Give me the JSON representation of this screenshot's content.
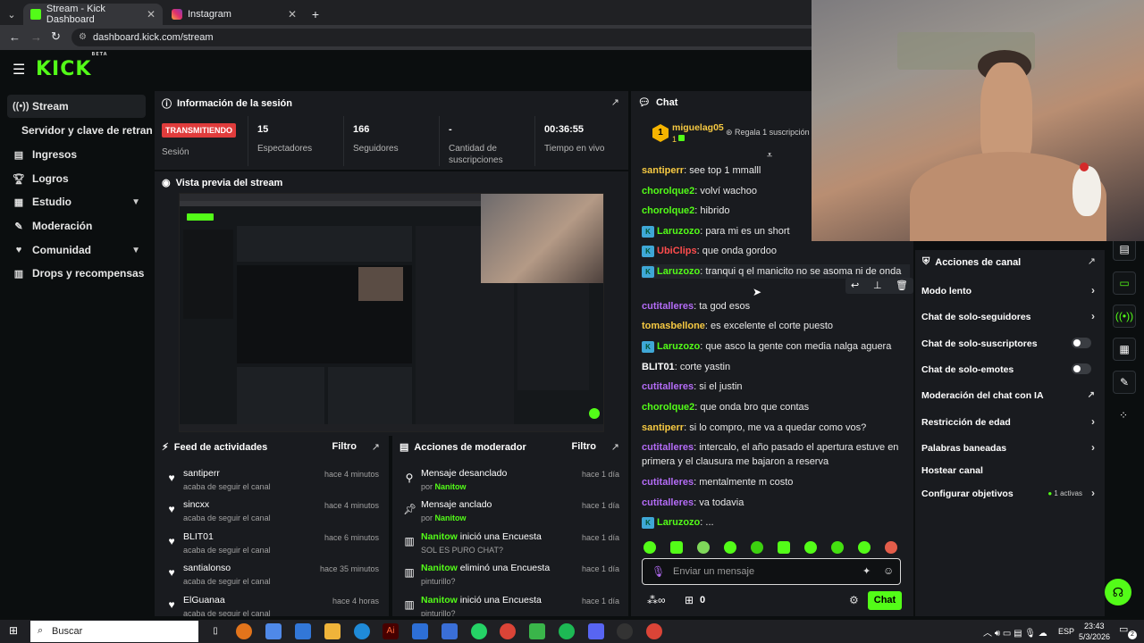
{
  "browser": {
    "tabs": [
      {
        "label": "Stream - Kick Dashboard",
        "icon": "kick-icon",
        "active": true
      },
      {
        "label": "Instagram",
        "icon": "instagram-icon",
        "active": false
      }
    ],
    "new_tab": "+",
    "url": "dashboard.kick.com/stream"
  },
  "brand": {
    "logo": "KICK",
    "logo_sup": "BETA",
    "accent": "#53fc18"
  },
  "sidebar": {
    "items": [
      {
        "label": "Stream",
        "icon": "stream-icon"
      },
      {
        "label": "Servidor y clave de retransm"
      },
      {
        "label": "Ingresos",
        "icon": "wallet-icon"
      },
      {
        "label": "Logros",
        "icon": "trophy-icon"
      },
      {
        "label": "Estudio",
        "icon": "studio-icon"
      },
      {
        "label": "Moderación",
        "icon": "wrench-icon"
      },
      {
        "label": "Comunidad",
        "icon": "community-icon"
      },
      {
        "label": "Drops y recompensas",
        "icon": "gift-icon"
      }
    ]
  },
  "session": {
    "title": "Información de la sesión",
    "status_badge": "TRANSMITIENDO",
    "status_label": "Sesión",
    "stats": [
      {
        "value": "15",
        "label": "Espectadores"
      },
      {
        "value": "166",
        "label": "Seguidores"
      },
      {
        "value": "-",
        "label": "Cantidad de suscripciones"
      },
      {
        "value": "00:36:55",
        "label": "Tiempo en vivo"
      }
    ]
  },
  "preview": {
    "title": "Vista previa del stream"
  },
  "activity": {
    "title": "Feed de actividades",
    "filter": "Filtro",
    "items": [
      {
        "name": "santiperr",
        "sub": "acaba de seguir el canal",
        "time": "hace 4 minutos"
      },
      {
        "name": "sincxx",
        "sub": "acaba de seguir el canal",
        "time": "hace 4 minutos"
      },
      {
        "name": "BLIT01",
        "sub": "acaba de seguir el canal",
        "time": "hace 6 minutos"
      },
      {
        "name": "santialonso",
        "sub": "acaba de seguir el canal",
        "time": "hace 35 minutos"
      },
      {
        "name": "ElGuanaa",
        "sub": "acaba de seguir el canal",
        "time": "hace 4 horas"
      }
    ]
  },
  "modactions": {
    "title": "Acciones de moderador",
    "filter": "Filtro",
    "items": [
      {
        "pre": "",
        "action": "Mensaje desanclado",
        "sub_pre": "por ",
        "sub_user": "Nanitow",
        "sub": "",
        "time": "hace 1 día",
        "icon": "unpin-icon"
      },
      {
        "pre": "",
        "action": "Mensaje anclado",
        "sub_pre": "por ",
        "sub_user": "Nanitow",
        "sub": "",
        "time": "hace 1 día",
        "icon": "pin-icon"
      },
      {
        "pre": "Nanitow",
        "action": " inició una Encuesta",
        "sub_pre": "",
        "sub_user": "",
        "sub": "SOL ES PURO CHAT?",
        "time": "hace 1 día",
        "icon": "poll-icon"
      },
      {
        "pre": "Nanitow",
        "action": " eliminó una Encuesta",
        "sub_pre": "",
        "sub_user": "",
        "sub": "pinturillo?",
        "time": "hace 1 día",
        "icon": "poll-icon"
      },
      {
        "pre": "Nanitow",
        "action": " inició una Encuesta",
        "sub_pre": "",
        "sub_user": "",
        "sub": "pinturillo?",
        "time": "hace 1 día",
        "icon": "poll-icon"
      }
    ]
  },
  "chat": {
    "title": "Chat",
    "pinned_user": "miguelag05",
    "pinned_count": "1",
    "pinned_rank": "1",
    "pinned_action": "Regala 1 suscripción",
    "messages": [
      {
        "user": "santiperr",
        "text": "see top 1 mmalll",
        "color": "yellow",
        "badge": false
      },
      {
        "user": "chorolque2",
        "text": "volví wachoo",
        "color": "green",
        "badge": false
      },
      {
        "user": "chorolque2",
        "text": "hibrido",
        "color": "green",
        "badge": false
      },
      {
        "user": "Laruzozo",
        "text": "para mi es un short",
        "color": "green",
        "badge": true
      },
      {
        "user": "UbiClips",
        "text": "que onda gordoo",
        "color": "red",
        "badge": true
      },
      {
        "user": "Laruzozo",
        "text": "tranqui q el manicito no se asoma ni de onda",
        "color": "green",
        "badge": true
      },
      {
        "user": "cutitalleres",
        "text": "ta god esos",
        "color": "purple",
        "badge": false
      },
      {
        "user": "tomasbellone",
        "text": "es excelente el corte puesto",
        "color": "yellow",
        "badge": false
      },
      {
        "user": "Laruzozo",
        "text": "que asco la gente con media nalga aguera",
        "color": "green",
        "badge": true
      },
      {
        "user": "BLIT01",
        "text": "corte yastin",
        "color": "white",
        "badge": false
      },
      {
        "user": "cutitalleres",
        "text": "si el justin",
        "color": "purple",
        "badge": false
      },
      {
        "user": "chorolque2",
        "text": "que onda bro que contas",
        "color": "green",
        "badge": false
      },
      {
        "user": "santiperr",
        "text": "si lo compro, me va a quedar como vos?",
        "color": "yellow",
        "badge": false
      },
      {
        "user": "cutitalleres",
        "text": "intercalo, el año pasado el apertura estuve en primera y el clausura me bajaron a reserva",
        "color": "purple",
        "badge": false
      },
      {
        "user": "cutitalleres",
        "text": "mentalmente m costo",
        "color": "purple",
        "badge": false
      },
      {
        "user": "cutitalleres",
        "text": "va todavia",
        "color": "purple",
        "badge": false
      },
      {
        "user": "Laruzozo",
        "text": "...",
        "color": "green",
        "badge": true
      }
    ],
    "input_placeholder": "Enviar un mensaje",
    "points": "0",
    "send_label": "Chat"
  },
  "channel_actions": {
    "title": "Acciones de canal",
    "items": [
      {
        "label": "Modo lento",
        "control": "chevron"
      },
      {
        "label": "Chat de solo-seguidores",
        "control": "chevron"
      },
      {
        "label": "Chat de solo-suscriptores",
        "control": "toggle"
      },
      {
        "label": "Chat de solo-emotes",
        "control": "toggle"
      },
      {
        "label": "Moderación del chat con IA",
        "control": "external"
      },
      {
        "label": "Restricción de edad",
        "control": "chevron"
      },
      {
        "label": "Palabras baneadas",
        "control": "chevron"
      },
      {
        "label": "Hostear canal",
        "control": "none"
      },
      {
        "label": "Configurar objetivos",
        "control": "chevron",
        "extra": "1 activas"
      }
    ]
  },
  "taskbar": {
    "search": "Buscar",
    "lang": "ESP",
    "time": "23:43",
    "date": "5/3/2026",
    "notif": "2"
  }
}
